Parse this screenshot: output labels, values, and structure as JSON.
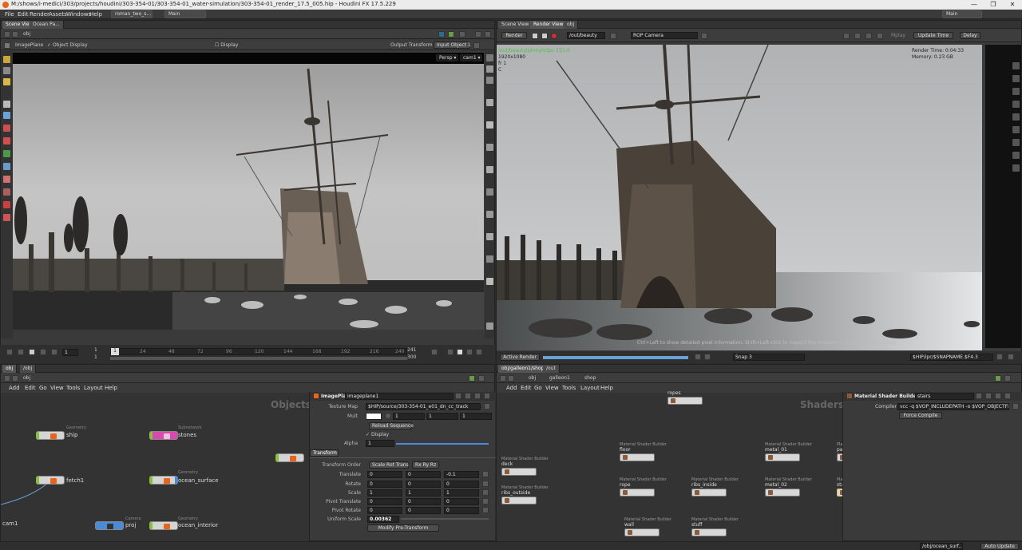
{
  "window": {
    "title": "M:/shows/i-medici/303/projects/houdini/303-354-01/303-354-01_water-simulation/303-354-01_render_17.5_005.hip - Houdini FX 17.5.229",
    "controls": [
      "—",
      "❐",
      "✕"
    ]
  },
  "menubar": {
    "items": [
      "File",
      "Edit",
      "Render",
      "Assets",
      "Windows",
      "Help"
    ],
    "desktop_tab": "roman_two_s...",
    "desktop": "Main",
    "desktop_right": "Main"
  },
  "scene_view": {
    "tabs": [
      "Scene View",
      "Ocean Pa..."
    ],
    "path": "obj",
    "toolbar": {
      "imageplane": "ImagePlane",
      "object_display": "Object Display",
      "display": "Display",
      "output_transform": "Output Transform",
      "input_object": "Input Object 1",
      "persp": "Persp ▾",
      "cam": "cam1 ▾"
    },
    "timeline": {
      "frame": "1",
      "start": "1",
      "end_top": "241",
      "end_bottom": "300",
      "ticks": [
        "1",
        "24",
        "48",
        "72",
        "96",
        "120",
        "144",
        "168",
        "192",
        "216",
        "240"
      ]
    }
  },
  "render_view": {
    "tabs": [
      "Scene View",
      "Render View",
      "obj"
    ],
    "toolbar": {
      "render": "Render",
      "rop": "/out/beauty",
      "camera": "ROP Camera",
      "mode": "Mplay",
      "update": "Update Time",
      "delay": "Delay"
    },
    "overlay": {
      "path": "/out/beauty[phmyhrtpc-1]|1.0",
      "res": "1920x1080",
      "fr": "fr 1",
      "c": "C",
      "render_time": "Render Time: 0:04:33",
      "memory": "Memory: 0.23 GB",
      "hint": "Ctrl+Left to show detailed pixel information. Shift+Left-click to inspect the material in the parameter dialog."
    },
    "bottom": {
      "active_render": "Active Render",
      "snap": "Snap 3",
      "output": "$HIP/ipr/$SNAPNAME.$F4.3"
    }
  },
  "network_left": {
    "path_tabs": [
      "obj",
      "/obj"
    ],
    "menu": [
      "Add",
      "Edit",
      "Go",
      "View",
      "Tools",
      "Layout",
      "Help"
    ],
    "context_label": "Objects",
    "nodes": [
      {
        "type": "Geometry",
        "name": "ship"
      },
      {
        "type": "Subnetwork",
        "name": "stones"
      },
      {
        "type": "",
        "name": "fetch1"
      },
      {
        "type": "Geometry",
        "name": "ocean_surface"
      },
      {
        "type": "Camera",
        "name": "proj"
      },
      {
        "type": "Geometry",
        "name": "ocean_interior"
      },
      {
        "type": "",
        "name": "cam1"
      }
    ]
  },
  "parameters_left": {
    "node_type": "ImagePlane",
    "node_name": "imageplane1",
    "texture_map_label": "Texture Map",
    "texture_map": "$HIP/source/303-354-01_e01_dn_cc_track",
    "mult_label": "Mult",
    "mult_values": [
      "1",
      "1",
      "1"
    ],
    "reload": "Reload Sequence",
    "display": "Display",
    "alpha_label": "Alpha",
    "alpha": "1",
    "transform_tab": "Transform",
    "rows": [
      {
        "label": "Transform Order",
        "values": [
          "Scale Rot Trans",
          "Rx Ry Rz"
        ]
      },
      {
        "label": "Translate",
        "values": [
          "0",
          "0",
          "-0.1"
        ]
      },
      {
        "label": "Rotate",
        "values": [
          "0",
          "0",
          "0"
        ]
      },
      {
        "label": "Scale",
        "values": [
          "1",
          "1",
          "1"
        ]
      },
      {
        "label": "Pivot Translate",
        "values": [
          "0",
          "0",
          "0"
        ]
      },
      {
        "label": "Pivot Rotate",
        "values": [
          "0",
          "0",
          "0"
        ]
      }
    ],
    "uniform_scale_label": "Uniform Scale",
    "uniform_scale": "0.00362",
    "modify_pre": "Modify Pre-Transform"
  },
  "network_right": {
    "path_tabs": [
      "obj/galleon1/shop",
      "/out"
    ],
    "breadcrumb": [
      "obj",
      "galleon1",
      "shop"
    ],
    "menu": [
      "Add",
      "Edit",
      "Go",
      "View",
      "Tools",
      "Layout",
      "Help"
    ],
    "context_label": "Shaders",
    "nodes": [
      {
        "type": "",
        "name": "ropes"
      },
      {
        "type": "Material Shader Builder",
        "name": "deck"
      },
      {
        "type": "Material Shader Builder",
        "name": "floor"
      },
      {
        "type": "Material Shader Builder",
        "name": "metal_01"
      },
      {
        "type": "Material Shader Builder",
        "name": "parda"
      },
      {
        "type": "Material Shader Builder",
        "name": "ribs_outside"
      },
      {
        "type": "Material Shader Builder",
        "name": "rope"
      },
      {
        "type": "Material Shader Builder",
        "name": "ribs_inside"
      },
      {
        "type": "Material Shader Builder",
        "name": "metal_02"
      },
      {
        "type": "Material Shader Builder",
        "name": "stairs"
      },
      {
        "type": "Material Shader Builder",
        "name": "wall"
      },
      {
        "type": "Material Shader Builder",
        "name": "stuff"
      }
    ]
  },
  "parameters_right": {
    "node_type": "Material Shader Builder",
    "node_name": "stairs",
    "compiler_label": "Compiler",
    "compiler": "vcc -q $VOP_INCLUDEPATH -o $VOP_OBJECTFILE -e",
    "force_compile": "Force Compile"
  },
  "statusbar": {
    "path": "/obj/ocean_surf...",
    "auto_update": "Auto Update"
  }
}
